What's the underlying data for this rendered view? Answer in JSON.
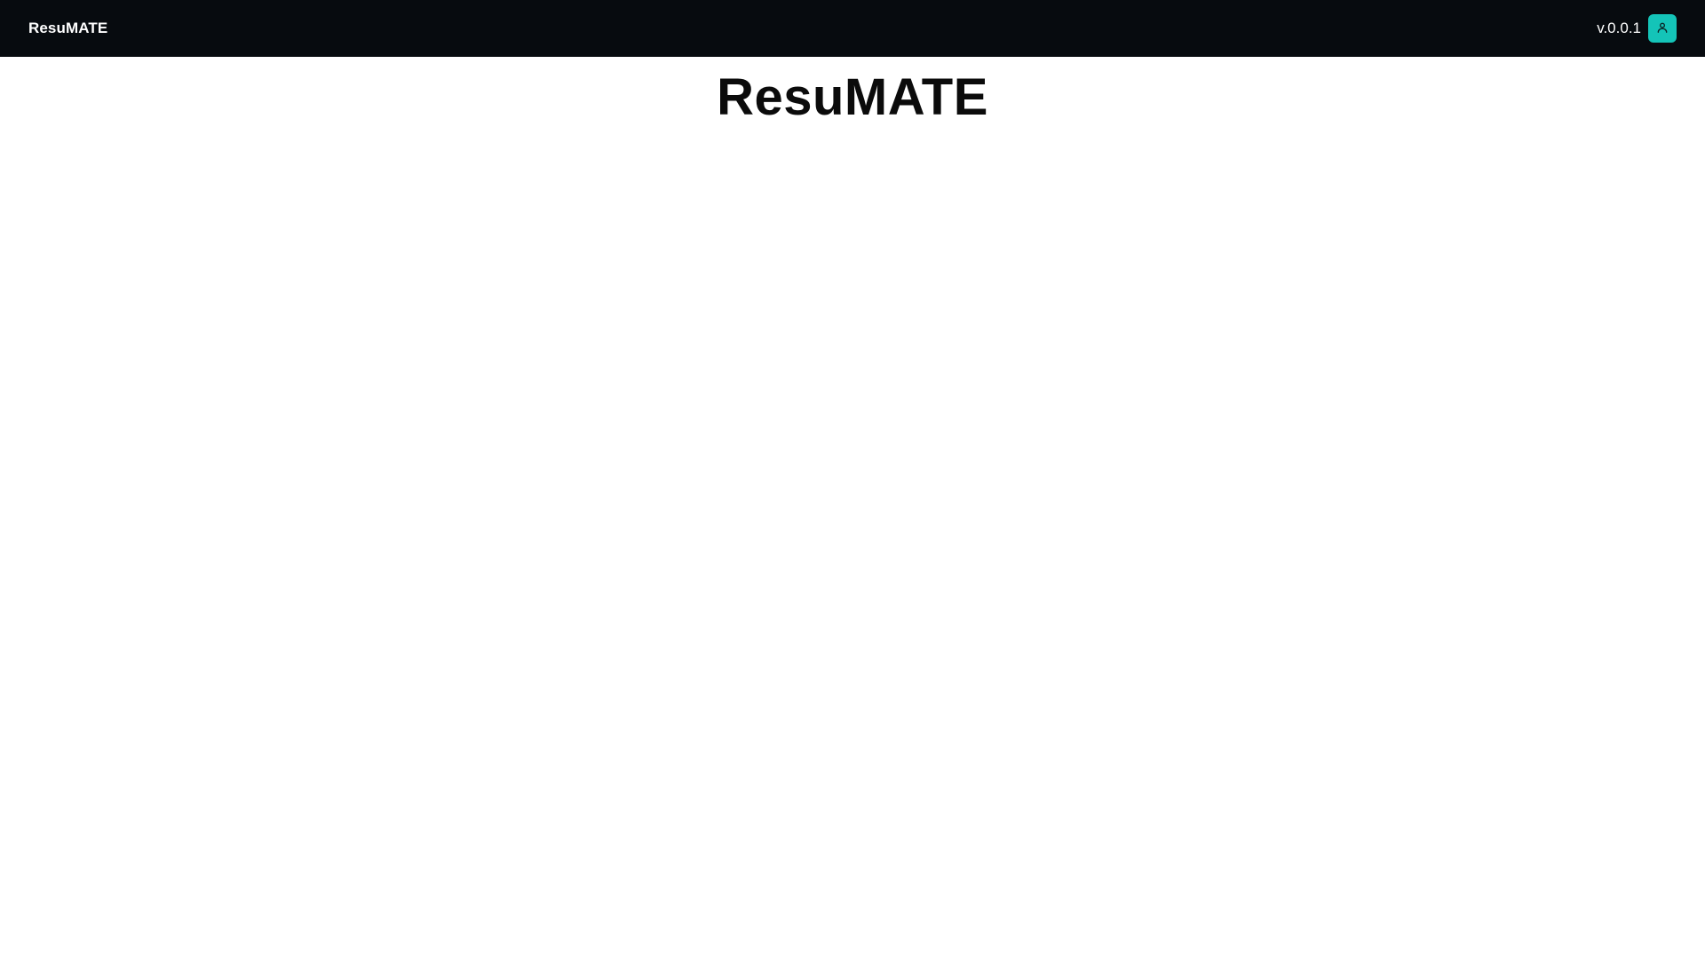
{
  "header": {
    "brand": "ResuMATE",
    "version": "v.0.0.1",
    "user_icon": "user-icon",
    "accent_color": "#14c4b8",
    "background_color": "#070b0f"
  },
  "main": {
    "title": "ResuMATE"
  }
}
